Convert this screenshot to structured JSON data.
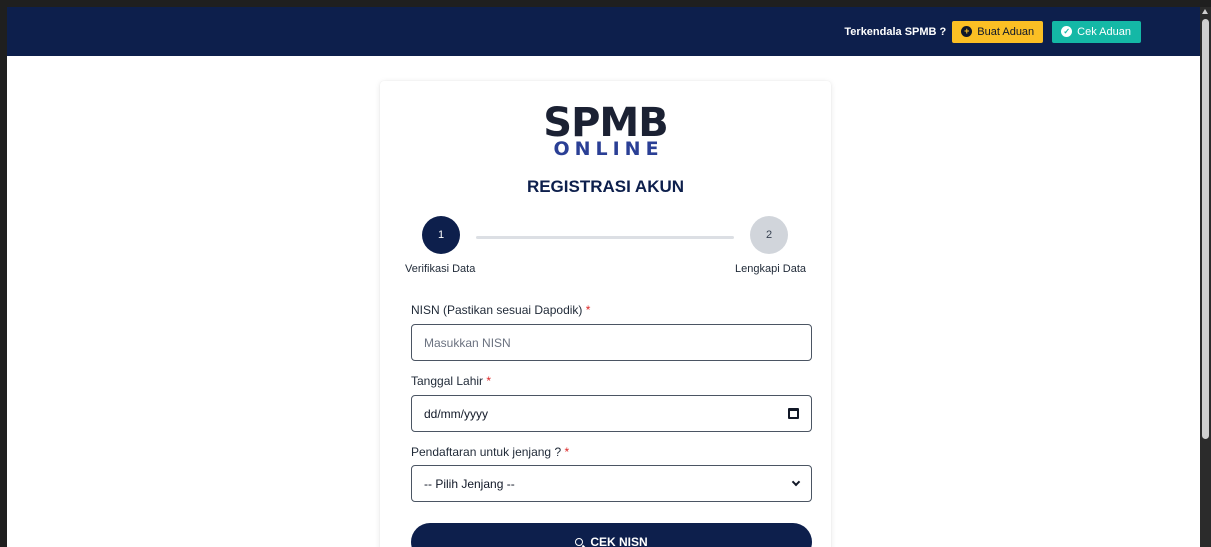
{
  "navbar": {
    "help_text": "Terkendala SPMB ?",
    "buat_aduan_label": "Buat Aduan",
    "cek_aduan_label": "Cek Aduan"
  },
  "logo": {
    "main": "SPMB",
    "sub": "ONLINE"
  },
  "page_title": "REGISTRASI AKUN",
  "stepper": {
    "steps": [
      {
        "number": "1",
        "label": "Verifikasi Data",
        "active": true
      },
      {
        "number": "2",
        "label": "Lengkapi Data",
        "active": false
      }
    ]
  },
  "form": {
    "nisn": {
      "label": "NISN (Pastikan sesuai Dapodik)",
      "required_mark": "*",
      "placeholder": "Masukkan NISN",
      "value": ""
    },
    "tanggal_lahir": {
      "label": "Tanggal Lahir",
      "required_mark": "*",
      "value": "dd/mm/yyyy"
    },
    "jenjang": {
      "label": "Pendaftaran untuk jenjang ?",
      "required_mark": "*",
      "selected": "-- Pilih Jenjang --"
    },
    "submit_label": "CEK NISN"
  },
  "colors": {
    "navy": "#0d1f4c",
    "yellow": "#fbbf24",
    "teal": "#14b8a6",
    "required": "#dc2626"
  }
}
